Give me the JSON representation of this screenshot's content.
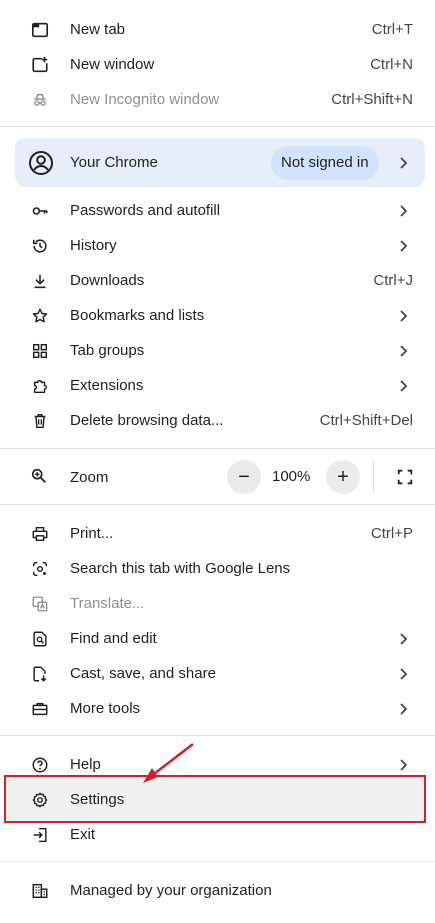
{
  "menu": {
    "top": [
      {
        "label": "New tab",
        "shortcut": "Ctrl+T",
        "icon": "new-tab-icon"
      },
      {
        "label": "New window",
        "shortcut": "Ctrl+N",
        "icon": "new-window-icon"
      },
      {
        "label": "New Incognito window",
        "shortcut": "Ctrl+Shift+N",
        "icon": "incognito-icon"
      }
    ],
    "profile": {
      "label": "Your Chrome",
      "status": "Not signed in"
    },
    "section2": [
      {
        "label": "Passwords and autofill",
        "icon": "key-icon"
      },
      {
        "label": "History",
        "icon": "history-icon"
      },
      {
        "label": "Downloads",
        "shortcut": "Ctrl+J",
        "icon": "download-icon"
      },
      {
        "label": "Bookmarks and lists",
        "icon": "star-icon"
      },
      {
        "label": "Tab groups",
        "icon": "tab-groups-icon"
      },
      {
        "label": "Extensions",
        "icon": "puzzle-icon"
      },
      {
        "label": "Delete browsing data...",
        "shortcut": "Ctrl+Shift+Del",
        "icon": "trash-icon"
      }
    ],
    "zoom": {
      "label": "Zoom",
      "value": "100%",
      "minus": "−",
      "plus": "+"
    },
    "section4": [
      {
        "label": "Print...",
        "shortcut": "Ctrl+P",
        "icon": "print-icon"
      },
      {
        "label": "Search this tab with Google Lens",
        "icon": "lens-icon"
      },
      {
        "label": "Translate...",
        "icon": "translate-icon"
      },
      {
        "label": "Find and edit",
        "icon": "find-icon"
      },
      {
        "label": "Cast, save, and share",
        "icon": "cast-save-icon"
      },
      {
        "label": "More tools",
        "icon": "toolbox-icon"
      }
    ],
    "section5": [
      {
        "label": "Help",
        "icon": "help-icon"
      },
      {
        "label": "Settings",
        "icon": "gear-icon"
      },
      {
        "label": "Exit",
        "icon": "exit-icon"
      }
    ],
    "managed": {
      "label": "Managed by your organization",
      "icon": "building-icon"
    }
  },
  "colors": {
    "highlight_border": "#d0202a",
    "profile_bg": "#e8eef9",
    "chip_bg": "#d3e3fd"
  }
}
